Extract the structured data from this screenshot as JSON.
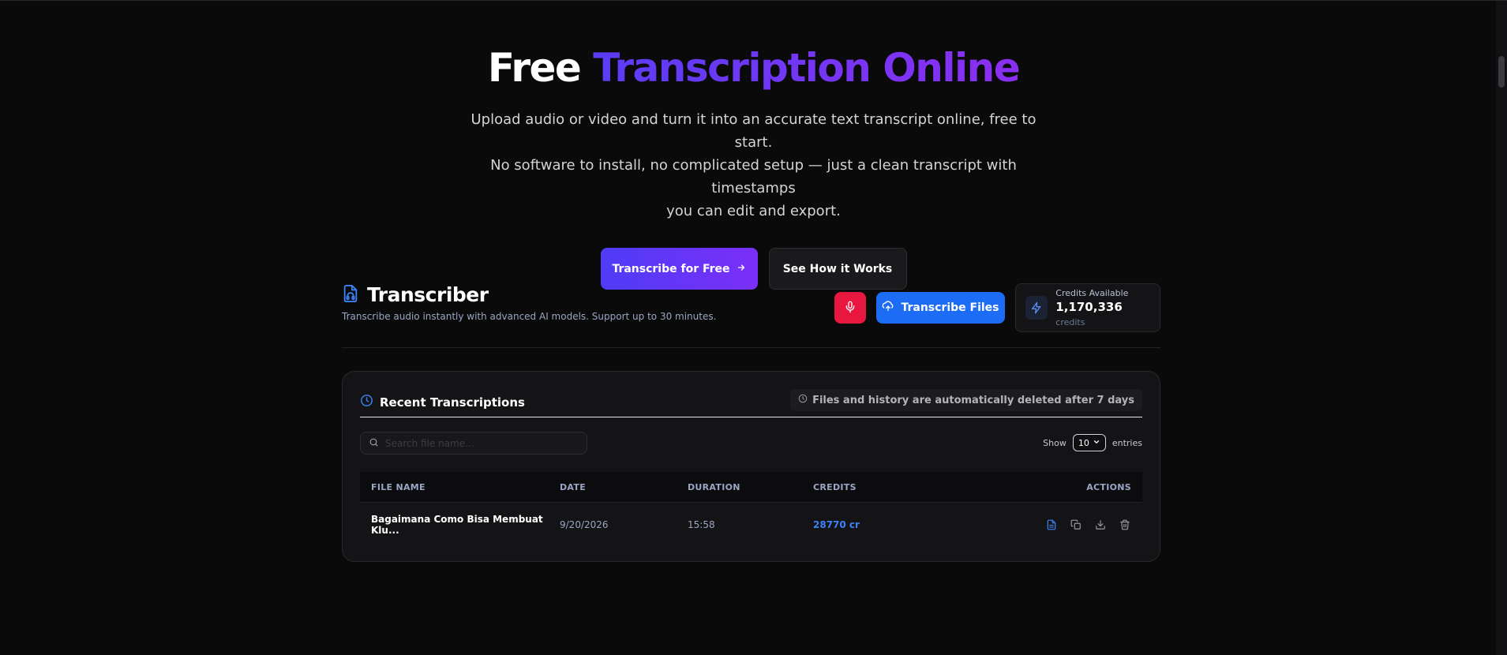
{
  "hero": {
    "title_plain": "Free",
    "title_gradient": "Transcription Online",
    "subtitle_line1": "Upload audio or video and turn it into an accurate text transcript online, free to start.",
    "subtitle_line2": "No software to install, no complicated setup — just a clean transcript with timestamps",
    "subtitle_line3": "you can edit and export.",
    "primary_cta": "Transcribe for Free",
    "secondary_cta": "See How it Works"
  },
  "transcriber": {
    "title": "Transcriber",
    "subtitle": "Transcribe audio instantly with advanced AI models. Support up to 30 minutes.",
    "files_button": "Transcribe Files",
    "credits": {
      "label": "Credits Available",
      "value": "1,170,336",
      "unit": "credits"
    }
  },
  "recent": {
    "title": "Recent Transcriptions",
    "notice": "Files and history are automatically deleted after 7 days",
    "search_placeholder": "Search file name...",
    "show_label": "Show",
    "entries_value": "10",
    "entries_label": "entries",
    "columns": {
      "name": "FILE NAME",
      "date": "DATE",
      "duration": "DURATION",
      "credits": "CREDITS",
      "actions": "ACTIONS"
    },
    "rows": [
      {
        "name": "Bagaimana Como Bisa Membuat Klu...",
        "date": "9/20/2026",
        "duration": "15:58",
        "credits": "28770 cr"
      }
    ]
  },
  "colors": {
    "accent_blue": "#1d6cf5",
    "mic_red": "#e8173f",
    "gradient_start": "#4f3cf7",
    "gradient_end": "#7b2ff7"
  }
}
